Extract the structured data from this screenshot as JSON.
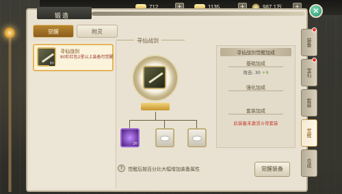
{
  "currency": [
    {
      "icon": "gold-ingot-icon",
      "value": "712"
    },
    {
      "icon": "silver-ingot-icon",
      "value": "1135"
    },
    {
      "icon": "coin-icon",
      "value": "987.1万"
    }
  ],
  "plus_label": "+",
  "close_label": "✕",
  "panel": {
    "title": "锻造",
    "tabs": [
      {
        "label": "觉醒",
        "active": true
      },
      {
        "label": "附灵",
        "active": false
      }
    ]
  },
  "item_list": [
    {
      "name": "寻仙战剑",
      "desc": "80阶红色2星以上装备可觉醒",
      "level": "80"
    }
  ],
  "center": {
    "title": "寻仙战剑",
    "hint": "觉醒后按百分比大幅增加装备属性",
    "main_level": "80",
    "slots": [
      {
        "type": "material-purple",
        "level": "20"
      },
      {
        "type": "material-grey",
        "level": ""
      },
      {
        "type": "material-grey",
        "level": ""
      }
    ]
  },
  "attributes": {
    "header": "寻仙战剑觉醒加成",
    "base_title": "基础加成",
    "base_stat_label": "攻击:",
    "base_stat_value": "30",
    "base_stat_plus": "+9",
    "enhance_title": "强化加成",
    "set_title": "套装加成",
    "set_warning": "此装备未激活斗帝套装"
  },
  "awaken_button": "觉醒装备",
  "side_tabs": [
    {
      "label": "装备",
      "active": false,
      "badge": true
    },
    {
      "label": "宝石",
      "active": false,
      "badge": true
    },
    {
      "label": "套装",
      "active": false,
      "badge": false
    },
    {
      "label": "觉醒",
      "active": true,
      "badge": false
    },
    {
      "label": "合成",
      "active": false,
      "badge": false
    }
  ],
  "colors": {
    "accent_gold": "#b7852f",
    "warning_red": "#c4372a",
    "badge_red": "#e03a2c",
    "close_green": "#1d8e6a"
  }
}
